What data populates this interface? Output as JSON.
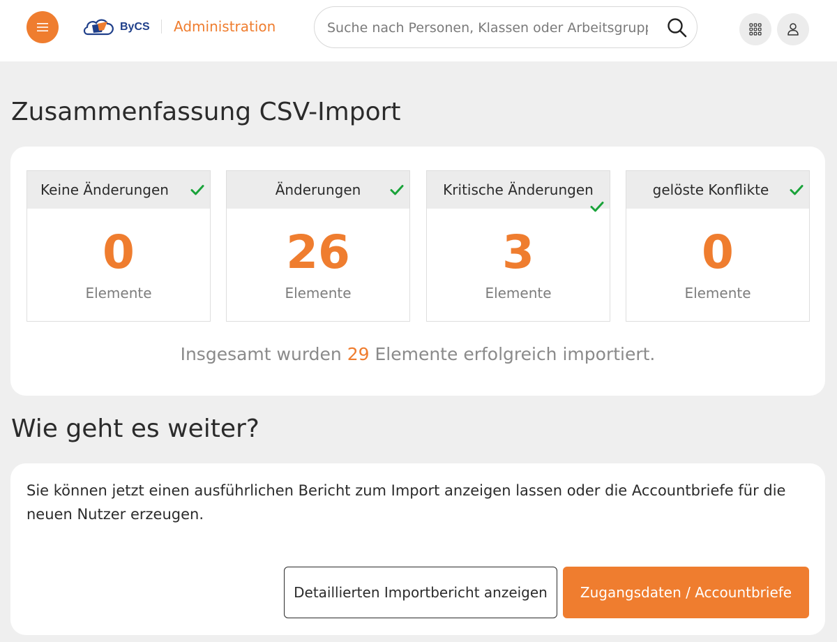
{
  "header": {
    "logo_text": "ByCS",
    "app_title": "Administration",
    "search_placeholder": "Suche nach Personen, Klassen oder Arbeitsgruppen"
  },
  "page": {
    "title": "Zusammenfassung CSV-Import"
  },
  "summary": {
    "cards": [
      {
        "label": "Keine Änderungen",
        "value": "0",
        "unit": "Elemente",
        "checked": true
      },
      {
        "label": "Änderungen",
        "value": "26",
        "unit": "Elemente",
        "checked": true
      },
      {
        "label": "Kritische Änderungen",
        "value": "3",
        "unit": "Elemente",
        "checked": true
      },
      {
        "label": "gelöste Konflikte",
        "value": "0",
        "unit": "Elemente",
        "checked": true
      }
    ],
    "total_prefix": "Insgesamt wurden",
    "total_count": "29",
    "total_suffix": "Elemente erfolgreich importiert."
  },
  "next": {
    "title": "Wie geht es weiter?",
    "text": "Sie können jetzt einen ausführlichen Bericht zum Import anzeigen lassen oder die Accountbriefe für die neuen Nutzer erzeugen.",
    "report_button": "Detaillierten Importbericht anzeigen",
    "letters_button": "Zugangsdaten / Accountbriefe"
  },
  "colors": {
    "accent": "#ef7d2f",
    "check": "#1aa33a",
    "brand_blue": "#1f3f8a"
  }
}
